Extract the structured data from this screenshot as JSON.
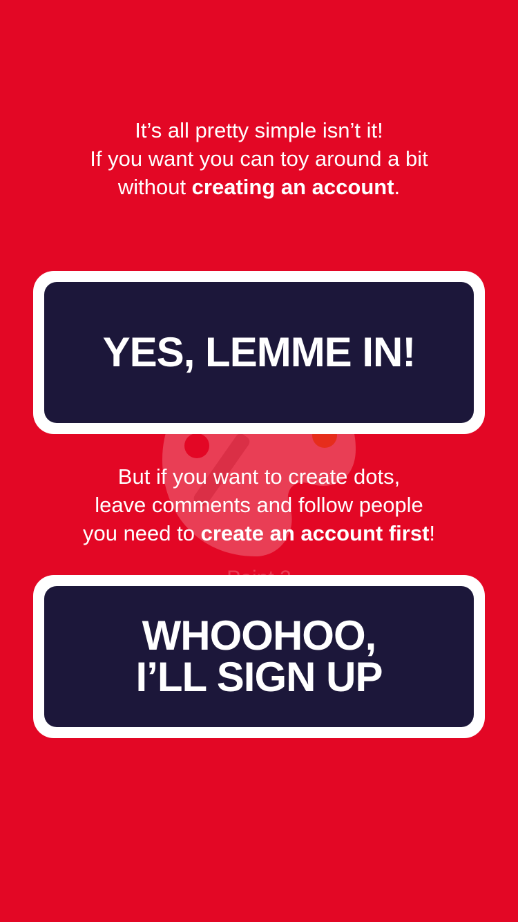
{
  "intro": {
    "line1": "It’s all pretty simple isn’t it!",
    "line2": "If you want you can toy around a bit",
    "line3_prefix": "without ",
    "line3_bold": "creating an account",
    "line3_suffix": "."
  },
  "primary_button": {
    "label": "YES, LEMME IN!"
  },
  "account_notice": {
    "line1": "But if you want to create dots,",
    "line2": "leave comments and follow people",
    "line3_prefix": "you need to ",
    "line3_bold": "create an account first",
    "line3_suffix": "!"
  },
  "signup_button": {
    "line1": "WHOOHOO,",
    "line2": "I’LL SIGN UP"
  },
  "watermark": {
    "icon": "paint-palette-icon",
    "caption": "Paint 2"
  },
  "colors": {
    "background": "#e30725",
    "button_fill": "#1c173a",
    "button_border": "#ffffff",
    "text": "#ffffff"
  }
}
